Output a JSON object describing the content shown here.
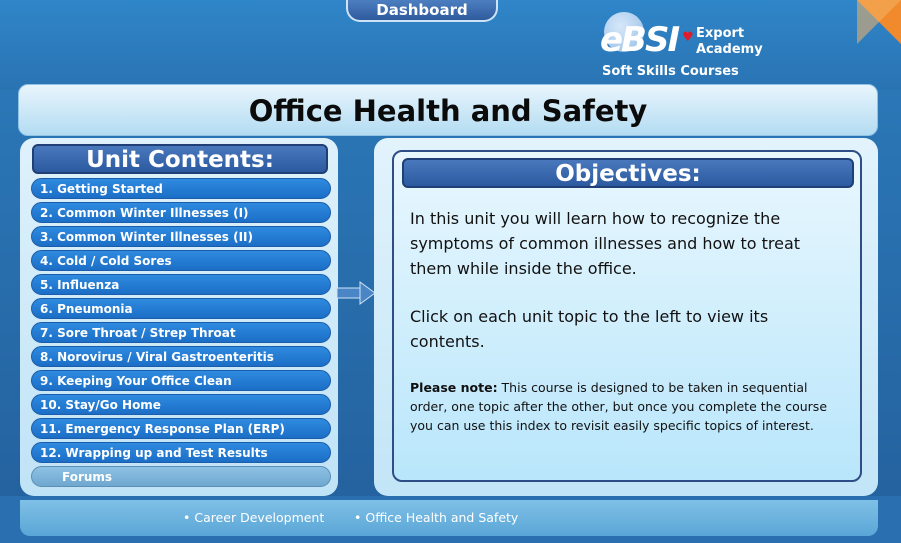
{
  "header": {
    "dashboard_label": "Dashboard",
    "logo": {
      "brand": "eBSI",
      "line1": "Export",
      "line2": "Academy",
      "tagline": "Soft Skills Courses"
    }
  },
  "page_title": "Office Health and Safety",
  "unit_contents": {
    "title": "Unit Contents:",
    "items": [
      "1. Getting Started",
      "2. Common Winter Illnesses (I)",
      "3. Common Winter Illnesses (II)",
      "4. Cold / Cold Sores",
      "5. Influenza",
      "6. Pneumonia",
      "7. Sore Throat / Strep Throat",
      "8. Norovirus / Viral Gastroenteritis",
      "9. Keeping Your Office Clean",
      "10. Stay/Go Home",
      "11. Emergency Response Plan (ERP)",
      "12. Wrapping up and Test Results"
    ],
    "forums_label": "Forums"
  },
  "objectives": {
    "title": "Objectives:",
    "paragraph1": "In this unit you will learn how to recognize the symptoms of common illnesses and how to treat them while inside the office.",
    "paragraph2": "Click on each unit topic to the left to view its contents.",
    "note_label": "Please note:",
    "note_text": " This course is designed to be taken in sequential order, one topic after the other, but once you complete the course you can use this index to revisit easily specific topics of interest."
  },
  "footer": {
    "breadcrumb": [
      "Career Development",
      "Office Health and Safety"
    ]
  },
  "colors": {
    "accent_blue": "#1c6ec6",
    "corner_orange": "#f08a2c",
    "heart_red": "#e01b2a"
  }
}
